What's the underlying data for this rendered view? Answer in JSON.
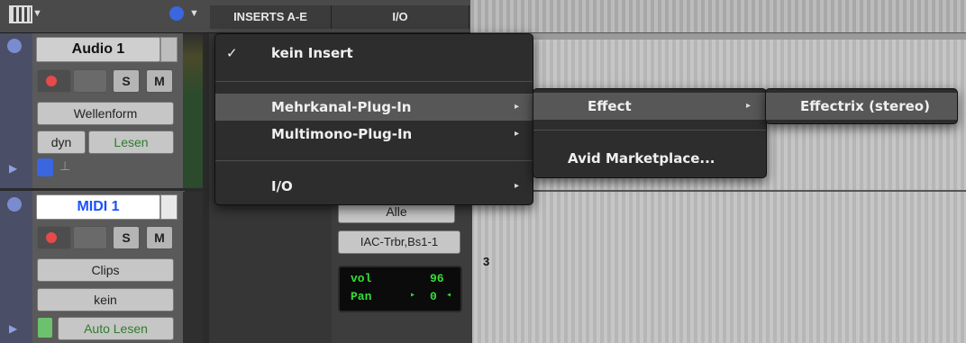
{
  "header": {
    "tab_inserts": "INSERTS A-E",
    "tab_io": "I/O"
  },
  "tracks": [
    {
      "name": "Audio 1",
      "solo_label": "S",
      "mute_label": "M",
      "view_mode": "Wellenform",
      "automation_left": "dyn",
      "automation_mode": "Lesen"
    },
    {
      "name": "MIDI 1",
      "solo_label": "S",
      "mute_label": "M",
      "view_mode": "Clips",
      "grouping": "kein",
      "automation_mode": "Auto Lesen"
    }
  ],
  "io": {
    "output_all": "Alle",
    "midi_output": "IAC-Trbr,Bs1-1",
    "channel_number": "3",
    "vol_label": "vol",
    "vol_value": "96",
    "pan_label": "Pan",
    "pan_value": "0"
  },
  "insert_menu": {
    "items": [
      {
        "label": "kein Insert",
        "checked": true
      },
      {
        "label": "Mehrkanal-Plug-In",
        "submenu": true,
        "highlighted": true
      },
      {
        "label": "Multimono-Plug-In",
        "submenu": true
      },
      {
        "label": "I/O",
        "submenu": true
      }
    ],
    "check_glyph": "✓",
    "submenu_arrow": "▸"
  },
  "submenu_1": {
    "items": [
      {
        "label": "Effect",
        "submenu": true,
        "highlighted": true
      },
      {
        "label": "Avid Marketplace..."
      }
    ]
  },
  "submenu_2": {
    "items": [
      {
        "label": "Effectrix (stereo)",
        "highlighted": true
      }
    ]
  },
  "colors": {
    "menu_bg": "#2d2d2d",
    "menu_highlight": "#575757",
    "midi_name": "#1a50ff",
    "record_red": "#e64a4a",
    "display_green": "#33e033"
  }
}
